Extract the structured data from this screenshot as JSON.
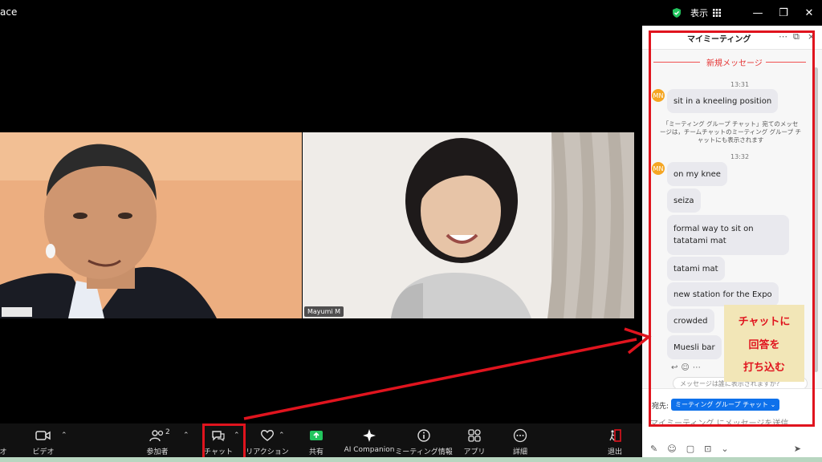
{
  "window": {
    "title": "ace",
    "view_label": "表示"
  },
  "participants": [
    {
      "name": ""
    },
    {
      "name": "Mayumi M"
    }
  ],
  "toolbar": {
    "audio_label": "オ",
    "video_label": "ビデオ",
    "participants_label": "参加者",
    "participants_count": "2",
    "chat_label": "チャット",
    "reactions_label": "リアクション",
    "share_label": "共有",
    "ai_label": "AI Companion",
    "info_label": "ミーティング情報",
    "apps_label": "アプリ",
    "more_label": "詳細",
    "leave_label": "退出"
  },
  "chat": {
    "title": "マイミーティング",
    "new_messages": "新規メッセージ",
    "avatar_initials": "MN",
    "groups": [
      {
        "time": "13:31",
        "messages": [
          "sit in a kneeling position"
        ]
      },
      {
        "time": "13:32",
        "messages": [
          "on my knee",
          "seiza",
          "formal way to sit on tatatami mat",
          "tatami mat",
          "new station for the Expo",
          "crowded",
          "Muesli bar"
        ]
      }
    ],
    "notice": "「ミーティング グループ チャット」宛てのメッセージは，チームチャットのミーティング グループ チャットにも表示されます",
    "hidden_pill": "メッセージは誰に表示されますか?",
    "to_label": "宛先:",
    "to_value": "ミーティング グループ チャット",
    "input_placeholder": "マイミーティング にメッセージを送信"
  },
  "annotation": {
    "lines": [
      "チャットに",
      "回答を",
      "打ち込む"
    ]
  },
  "colors": {
    "accent_red": "#e0141e",
    "zoom_blue": "#0e71eb",
    "share_green": "#22c55e"
  }
}
